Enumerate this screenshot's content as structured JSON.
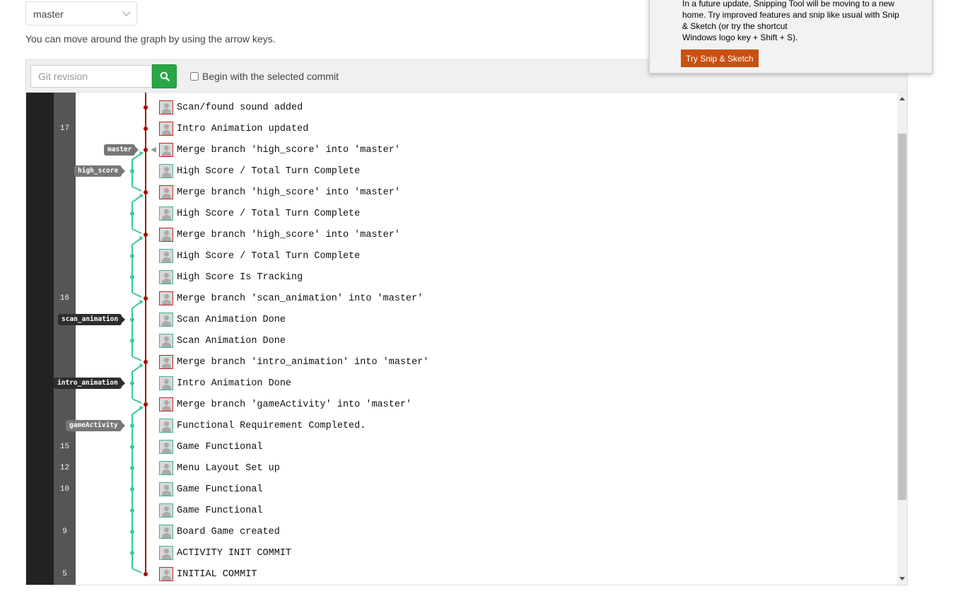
{
  "branch_select": {
    "value": "master"
  },
  "hint": "You can move around the graph by using the arrow keys.",
  "toolbar": {
    "revision_placeholder": "Git revision",
    "begin_label": "Begin with the selected commit"
  },
  "commits": [
    {
      "message": "Scan/found sound added",
      "number": "",
      "lane": "main"
    },
    {
      "message": "Intro Animation updated",
      "number": "17",
      "lane": "main"
    },
    {
      "message": "Merge branch 'high_score' into 'master'",
      "number": "",
      "lane": "main"
    },
    {
      "message": "High Score / Total Turn Complete",
      "number": "",
      "lane": "branch"
    },
    {
      "message": "Merge branch 'high_score' into 'master'",
      "number": "",
      "lane": "main"
    },
    {
      "message": "High Score / Total Turn Complete",
      "number": "",
      "lane": "branch"
    },
    {
      "message": "Merge branch 'high_score' into 'master'",
      "number": "",
      "lane": "main"
    },
    {
      "message": "High Score / Total Turn Complete",
      "number": "",
      "lane": "branch"
    },
    {
      "message": "High Score Is Tracking",
      "number": "",
      "lane": "branch"
    },
    {
      "message": "Merge branch 'scan_animation' into 'master'",
      "number": "16",
      "lane": "main"
    },
    {
      "message": "Scan Animation Done",
      "number": "",
      "lane": "branch"
    },
    {
      "message": "Scan Animation Done",
      "number": "",
      "lane": "branch"
    },
    {
      "message": "Merge branch 'intro_animation' into 'master'",
      "number": "",
      "lane": "main"
    },
    {
      "message": "Intro Animation Done",
      "number": "",
      "lane": "branch"
    },
    {
      "message": "Merge branch 'gameActivity' into 'master'",
      "number": "",
      "lane": "main"
    },
    {
      "message": "Functional Requirement Completed.",
      "number": "",
      "lane": "branch"
    },
    {
      "message": "Game Functional",
      "number": "15",
      "lane": "branch"
    },
    {
      "message": "Menu Layout Set up",
      "number": "12",
      "lane": "branch"
    },
    {
      "message": "Game Functional",
      "number": "10",
      "lane": "branch"
    },
    {
      "message": "Game Functional",
      "number": "",
      "lane": "branch"
    },
    {
      "message": "Board Game created",
      "number": "9",
      "lane": "branch"
    },
    {
      "message": "ACTIVITY INIT COMMIT",
      "number": "",
      "lane": "branch"
    },
    {
      "message": "INITIAL COMMIT",
      "number": "5",
      "lane": "main"
    }
  ],
  "refs": [
    {
      "name": "master",
      "row": 2,
      "style": "grey"
    },
    {
      "name": "high_score",
      "row": 3,
      "style": "grey"
    },
    {
      "name": "scan_animation",
      "row": 10,
      "style": "dark"
    },
    {
      "name": "intro_animation",
      "row": 13,
      "style": "dark"
    },
    {
      "name": "gameActivity",
      "row": 15,
      "style": "grey"
    }
  ],
  "colors": {
    "main_line": "#b30000",
    "branch_line": "#3cc99a",
    "search_button": "#27a745",
    "popup_button": "#ca5010"
  },
  "popup": {
    "lines": [
      "In a future update, Snipping Tool will be moving to a new",
      "home. Try improved features and snip like usual with Snip",
      "& Sketch (or try the shortcut",
      "Windows logo key + Shift + S)."
    ],
    "button": "Try Snip & Sketch"
  },
  "icons": {
    "search": "search-icon",
    "avatar": "avatar-icon"
  }
}
